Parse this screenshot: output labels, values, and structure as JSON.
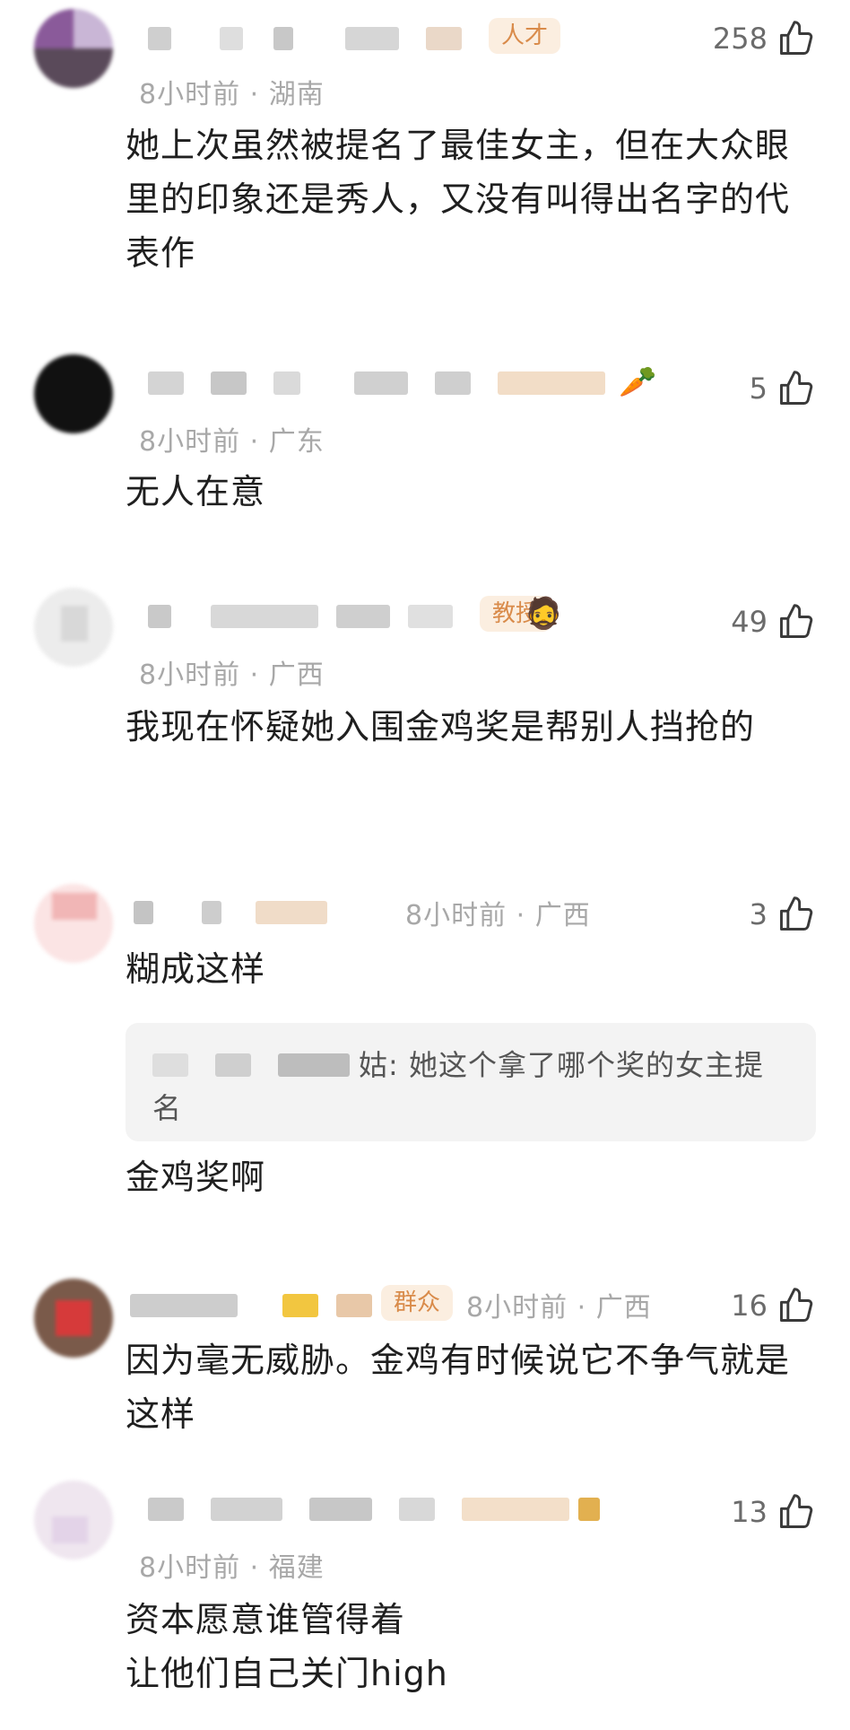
{
  "comments": [
    {
      "badge": "人才",
      "meta": "8小时前 · 湖南",
      "likes": "258",
      "text": "她上次虽然被提名了最佳女主，但在大众眼里的印象还是秀人，又没有叫得出名字的代表作"
    },
    {
      "emoji": "🥕",
      "meta": "8小时前 · 广东",
      "likes": "5",
      "text": "无人在意"
    },
    {
      "badge": "教授",
      "emoji": "🧔",
      "meta": "8小时前 · 广西",
      "likes": "49",
      "text": "我现在怀疑她入围金鸡奖是帮别人挡抢的"
    },
    {
      "meta": "8小时前 · 广西",
      "likes": "3",
      "text": "糊成这样",
      "reply_suffix": "姑: 她这个拿了哪个奖的女主提",
      "reply_tail": "名",
      "reply_answer": "金鸡奖啊"
    },
    {
      "badge": "群众",
      "meta": "8小时前 · 广西",
      "likes": "16",
      "text": "因为毫无威胁。金鸡有时候说它不争气就是这样"
    },
    {
      "meta": "8小时前 · 福建",
      "likes": "13",
      "text_line1": "资本愿意谁管得着",
      "text_line2": "让他们自己关门high"
    }
  ],
  "icons": {
    "like": "thumbs-up-outline-icon"
  }
}
